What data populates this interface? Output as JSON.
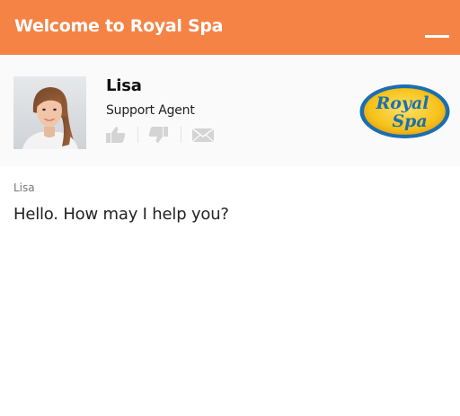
{
  "header": {
    "title": "Welcome to Royal Spa",
    "minimize_icon": "minimize-icon",
    "background_color": "#f58345"
  },
  "agent": {
    "name": "Lisa",
    "role": "Support Agent",
    "photo": "agent-photo",
    "actions": [
      {
        "icon": "thumbs-up-icon"
      },
      {
        "icon": "thumbs-down-icon"
      },
      {
        "icon": "envelope-icon"
      }
    ],
    "icon_color": "#d4d4d4"
  },
  "brand": {
    "logo_text_1": "Royal",
    "logo_text_2": "Spa",
    "logo_colors": {
      "fill": "#f2c21b",
      "ring": "#1a6fb0",
      "text": "#1a6fb0"
    }
  },
  "messages": [
    {
      "sender": "Lisa",
      "text": "Hello. How may I help you?"
    }
  ]
}
